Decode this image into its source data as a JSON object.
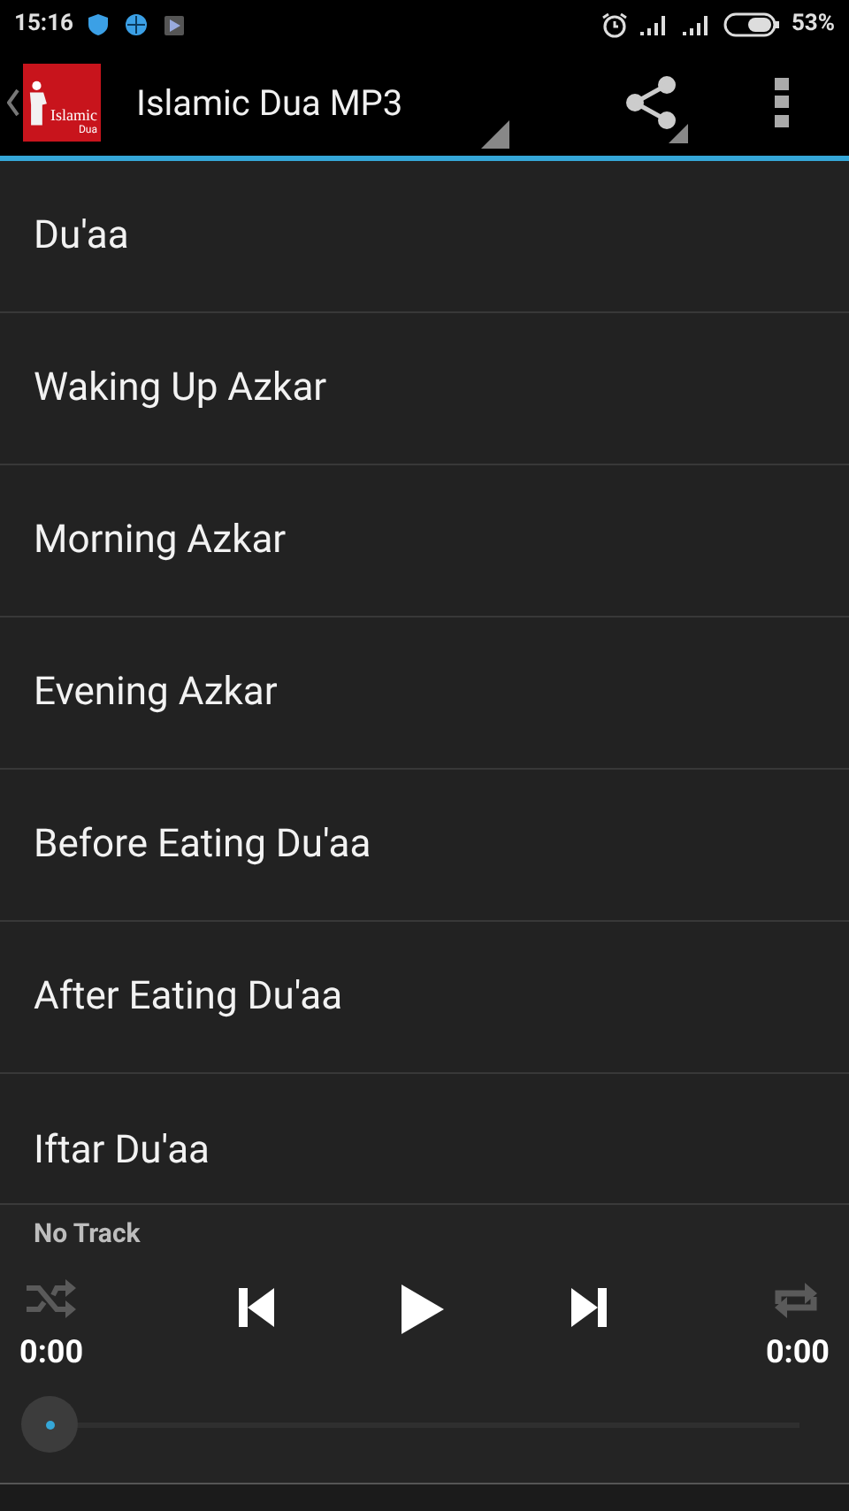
{
  "status_bar": {
    "time": "15:16",
    "battery": "53%"
  },
  "app_bar": {
    "logo": {
      "line_1": "Islamic",
      "line_2": "Dua"
    },
    "title": "Islamic Dua MP3"
  },
  "list": [
    {
      "label": "Du'aa"
    },
    {
      "label": "Waking Up Azkar"
    },
    {
      "label": "Morning Azkar"
    },
    {
      "label": "Evening Azkar"
    },
    {
      "label": "Before Eating Du'aa"
    },
    {
      "label": "After Eating Du'aa"
    },
    {
      "label": "Iftar Du'aa"
    }
  ],
  "player": {
    "track": "No Track",
    "elapsed": "0:00",
    "duration": "0:00",
    "shuffle": false,
    "repeat": false
  }
}
